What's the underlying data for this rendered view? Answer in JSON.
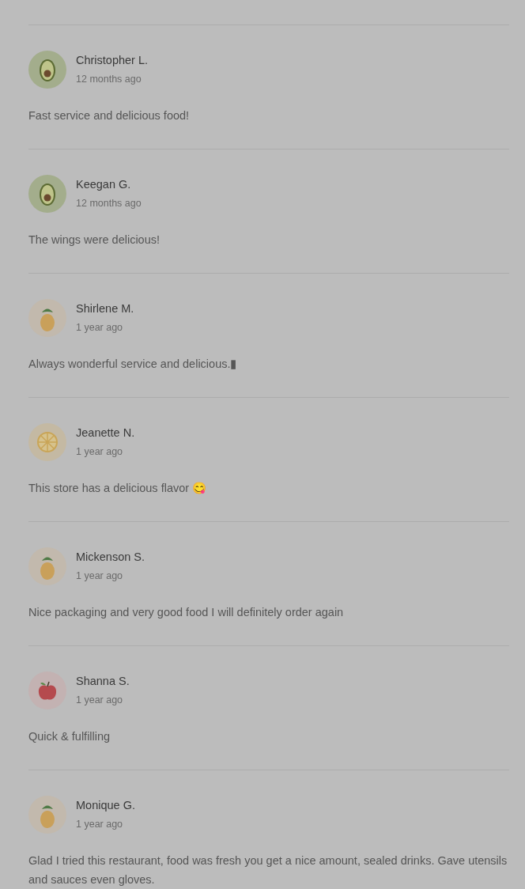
{
  "reviews": [
    {
      "name": "Christopher L.",
      "time": "12 months ago",
      "kind": "avocado",
      "text": "Fast service and delicious food!"
    },
    {
      "name": "Keegan G.",
      "time": "12 months ago",
      "kind": "avocado",
      "text": "The wings were delicious!"
    },
    {
      "name": "Shirlene M.",
      "time": "1 year ago",
      "kind": "pineapple",
      "text": "Always wonderful service and delicious.▮"
    },
    {
      "name": "Jeanette N.",
      "time": "1 year ago",
      "kind": "lemon",
      "text": "This store has a delicious flavor 😋"
    },
    {
      "name": "Mickenson S.",
      "time": "1 year ago",
      "kind": "pineapple",
      "text": "Nice packaging and very good food I will definitely order again"
    },
    {
      "name": "Shanna S.",
      "time": "1 year ago",
      "kind": "apple",
      "text": "Quick & fulfilling"
    },
    {
      "name": "Monique G.",
      "time": "1 year ago",
      "kind": "pineapple",
      "text": "Glad I tried this restaurant, food was fresh you get a nice amount, sealed drinks. Gave utensils and sauces even gloves."
    }
  ]
}
